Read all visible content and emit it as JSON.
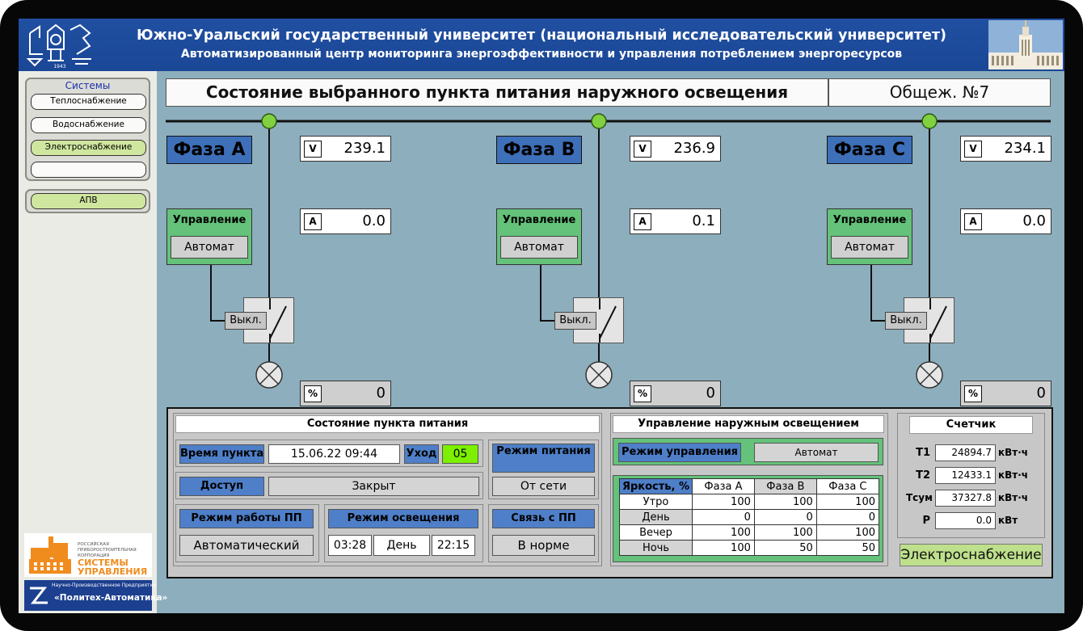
{
  "header": {
    "title": "Южно-Уральский государственный университет (национальный исследовательский университет)",
    "subtitle": "Автоматизированный центр мониторинга энергоэффективности и управления потреблением энергоресурсов",
    "logo_year": "1943"
  },
  "sidebar": {
    "group_title": "Системы",
    "items": [
      {
        "label": "Теплоснабжение",
        "active": false
      },
      {
        "label": "Водоснабжение",
        "active": false
      },
      {
        "label": "Электроснабжение",
        "active": true
      },
      {
        "label": "",
        "active": false
      }
    ],
    "apv_label": "АПВ",
    "corp": {
      "line1": "РОССИЙСКАЯ",
      "line2": "ПРИБОРОСТРОИТЕЛЬНАЯ",
      "line3": "КОРПОРАЦИЯ",
      "line4": "СИСТЕМЫ",
      "line5": "УПРАВЛЕНИЯ"
    },
    "polit": {
      "small": "Научно-Производственное Предприятие",
      "name": "«Политех-Автоматика»"
    }
  },
  "main": {
    "title": "Состояние выбранного пункта питания наружного освещения",
    "object": "Общеж. №7"
  },
  "phases": [
    {
      "name": "Фаза А",
      "voltage_unit": "V",
      "voltage": "239.1",
      "current_unit": "A",
      "current": "0.0",
      "pct_unit": "%",
      "pct": "0",
      "ctrl_label": "Управление",
      "ctrl_mode": "Автомат",
      "switch_label": "Выкл."
    },
    {
      "name": "Фаза В",
      "voltage_unit": "V",
      "voltage": "236.9",
      "current_unit": "A",
      "current": "0.1",
      "pct_unit": "%",
      "pct": "0",
      "ctrl_label": "Управление",
      "ctrl_mode": "Автомат",
      "switch_label": "Выкл."
    },
    {
      "name": "Фаза С",
      "voltage_unit": "V",
      "voltage": "234.1",
      "current_unit": "A",
      "current": "0.0",
      "pct_unit": "%",
      "pct": "0",
      "ctrl_label": "Управление",
      "ctrl_mode": "Автомат",
      "switch_label": "Выкл."
    }
  ],
  "status": {
    "title": "Состояние пункта питания",
    "time_label": "Время пункта",
    "time_value": "15.06.22 09:44",
    "uhod_label": "Уход",
    "uhod_value": "05",
    "power_mode_label": "Режим питания",
    "power_mode_value": "От сети",
    "access_label": "Доступ",
    "access_value": "Закрыт",
    "work_mode_label": "Режим работы ПП",
    "work_mode_value": "Автоматический",
    "light_mode_label": "Режим освещения",
    "light_start": "03:28",
    "light_period": "День",
    "light_end": "22:15",
    "link_label": "Связь с ПП",
    "link_value": "В норме"
  },
  "lighting": {
    "title": "Управление наружным освещением",
    "mode_label": "Режим управления",
    "mode_value": "Автомат",
    "table_header": [
      "Яркость, %",
      "Фаза А",
      "Фаза В",
      "Фаза С"
    ],
    "rows": [
      {
        "label": "Утро",
        "a": "100",
        "b": "100",
        "c": "100"
      },
      {
        "label": "День",
        "a": "0",
        "b": "0",
        "c": "0"
      },
      {
        "label": "Вечер",
        "a": "100",
        "b": "100",
        "c": "100"
      },
      {
        "label": "Ночь",
        "a": "100",
        "b": "50",
        "c": "50"
      }
    ]
  },
  "counter": {
    "title": "Счетчик",
    "rows": [
      {
        "key": "T1",
        "value": "24894.7",
        "unit": "кВт·ч"
      },
      {
        "key": "T2",
        "value": "12433.1",
        "unit": "кВт·ч"
      },
      {
        "key": "Tсум",
        "value": "37327.8",
        "unit": "кВт·ч"
      },
      {
        "key": "P",
        "value": "0.0",
        "unit": "кВт"
      }
    ]
  },
  "footer_button": "Электроснабжение",
  "colors": {
    "header_blue": "#1a4796",
    "phase_blue": "#3e6fb9",
    "ctrl_green": "#64c27a",
    "active_green": "#cfe69f",
    "uhod_green": "#7cf000",
    "background": "#8daebd"
  }
}
